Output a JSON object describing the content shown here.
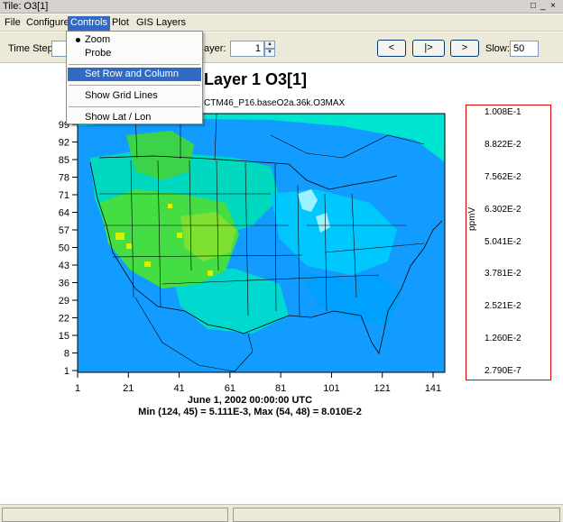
{
  "window": {
    "title": "Tile: O3[1]",
    "controls": [
      "□",
      "_",
      "×"
    ]
  },
  "menubar": {
    "items": [
      {
        "label": "File",
        "name": "menu-file"
      },
      {
        "label": "Configure",
        "name": "menu-configure"
      },
      {
        "label": "Controls",
        "name": "menu-controls"
      },
      {
        "label": "Plot",
        "name": "menu-plot"
      },
      {
        "label": "GIS Layers",
        "name": "menu-gis-layers"
      }
    ]
  },
  "controls_menu": {
    "zoom": "Zoom",
    "probe": "Probe",
    "set_ranges": "Set Row and Column Ranges",
    "grid_lines": "Show Grid Lines",
    "lat_lon": "Show Lat / Lon",
    "selected": "Zoom",
    "highlighted": "Set Row and Column Ranges"
  },
  "toolbar": {
    "time_step_label": "Time Step:",
    "layer_label": "ayer:",
    "layer_value": "1",
    "prev_label": "<",
    "play_label": "|>",
    "next_label": ">",
    "slow_label": "Slow:",
    "slow_value": "50"
  },
  "plot": {
    "title": "Layer 1 O3[1]",
    "subtitle": "CTM46_P16.baseO2a.36k.O3MAX",
    "date": "June 1, 2002 00:00:00 UTC",
    "minmax": "Min (124, 45) = 5.111E-3, Max (54, 48) = 8.010E-2",
    "y_ticks": [
      "99",
      "92",
      "85",
      "78",
      "71",
      "64",
      "57",
      "50",
      "43",
      "36",
      "29",
      "22",
      "15",
      "8",
      "1"
    ],
    "x_ticks": [
      "1",
      "21",
      "41",
      "61",
      "81",
      "101",
      "121",
      "141"
    ]
  },
  "legend": {
    "unit": "ppmV",
    "labels": [
      "1.008E-1",
      "8.822E-2",
      "7.562E-2",
      "6.302E-2",
      "5.041E-2",
      "3.781E-2",
      "2.521E-2",
      "1.260E-2",
      "2.790E-7"
    ],
    "colors": [
      "#ff0000",
      "#ff8c00",
      "#c8f000",
      "#32cd32",
      "#00ffd0",
      "#00aaff",
      "#0044ff",
      "#d8d8d8"
    ]
  },
  "colors": {
    "menu_highlight": "#316ac5",
    "legend_border": "#e00000"
  }
}
